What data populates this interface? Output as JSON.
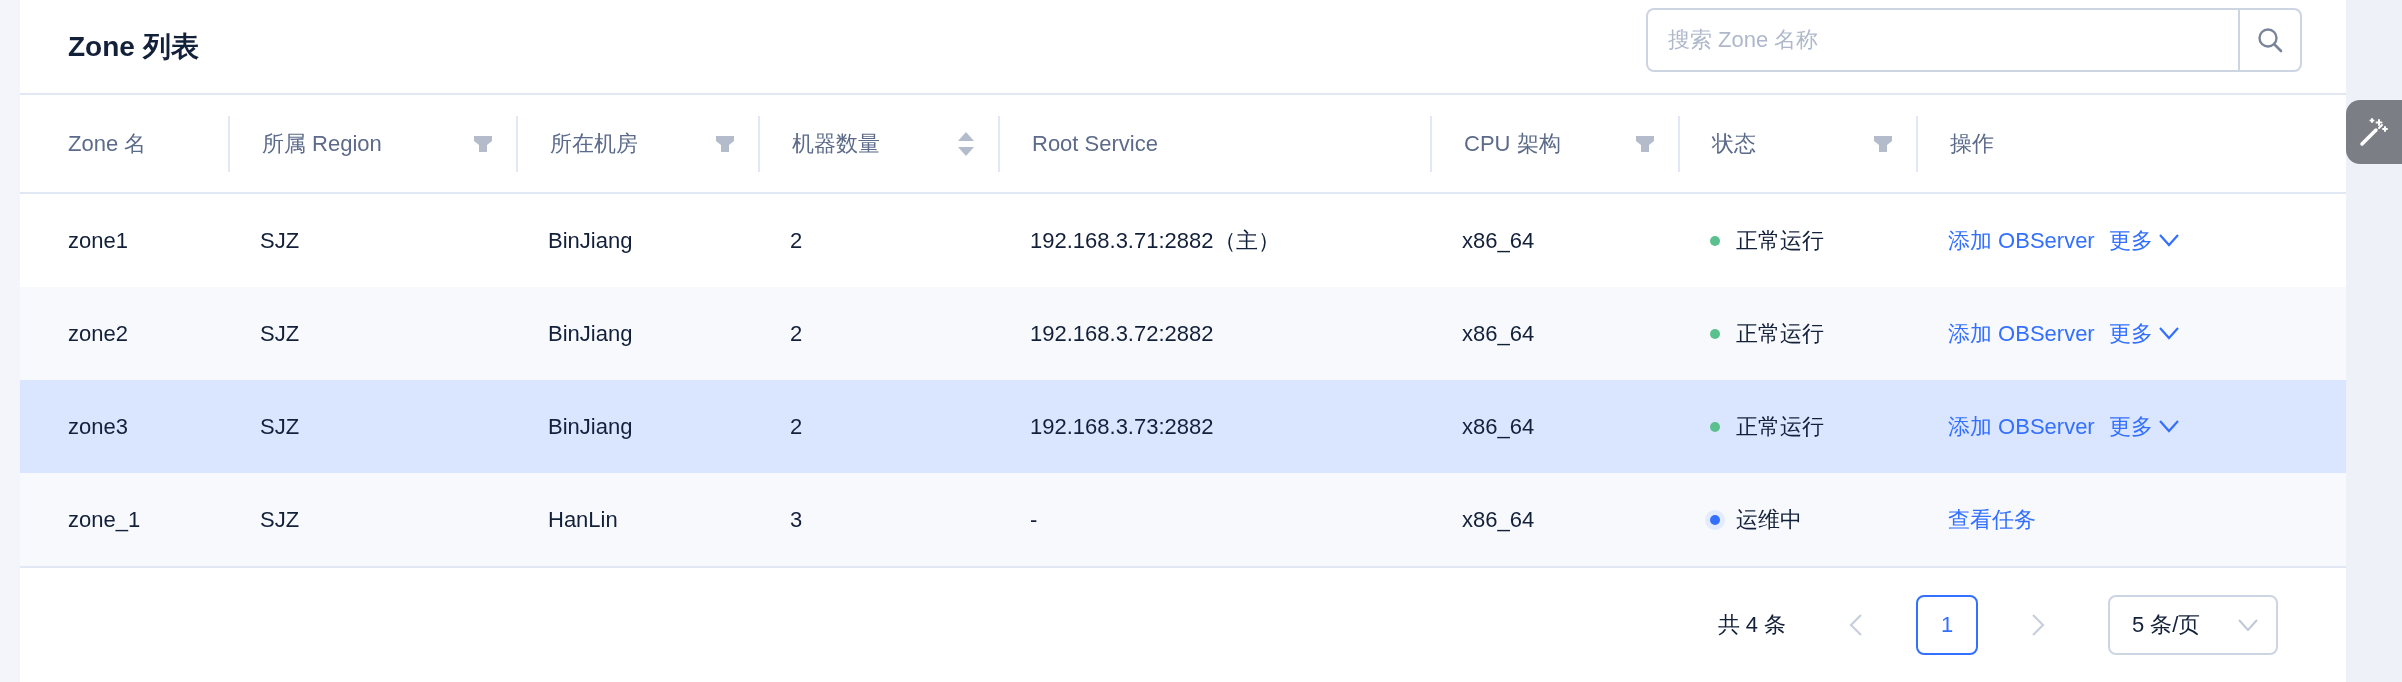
{
  "title": "Zone 列表",
  "search": {
    "placeholder": "搜索 Zone 名称"
  },
  "table": {
    "columns": [
      {
        "label": "Zone 名",
        "kind": "plain"
      },
      {
        "label": "所属 Region",
        "kind": "filter"
      },
      {
        "label": "所在机房",
        "kind": "filter"
      },
      {
        "label": "机器数量",
        "kind": "sort"
      },
      {
        "label": "Root Service",
        "kind": "plain"
      },
      {
        "label": "CPU 架构",
        "kind": "filter"
      },
      {
        "label": "状态",
        "kind": "filter"
      },
      {
        "label": "操作",
        "kind": "plain"
      }
    ],
    "rows": [
      {
        "cells": [
          "zone1",
          "SJZ",
          "BinJiang",
          "2",
          "192.168.3.71:2882（主）",
          "x86_64"
        ],
        "status": {
          "label": "正常运行",
          "kind": "static",
          "color": "#5ac18e"
        },
        "actions": [
          {
            "label": "添加 OBServer",
            "kind": "link"
          },
          {
            "label": "更多",
            "kind": "dropdown"
          }
        ],
        "selected": false
      },
      {
        "cells": [
          "zone2",
          "SJZ",
          "BinJiang",
          "2",
          "192.168.3.72:2882",
          "x86_64"
        ],
        "status": {
          "label": "正常运行",
          "kind": "static",
          "color": "#5ac18e"
        },
        "actions": [
          {
            "label": "添加 OBServer",
            "kind": "link"
          },
          {
            "label": "更多",
            "kind": "dropdown"
          }
        ],
        "selected": false
      },
      {
        "cells": [
          "zone3",
          "SJZ",
          "BinJiang",
          "2",
          "192.168.3.73:2882",
          "x86_64"
        ],
        "status": {
          "label": "正常运行",
          "kind": "static",
          "color": "#5ac18e"
        },
        "actions": [
          {
            "label": "添加 OBServer",
            "kind": "link"
          },
          {
            "label": "更多",
            "kind": "dropdown"
          }
        ],
        "selected": true
      },
      {
        "cells": [
          "zone_1",
          "SJZ",
          "HanLin",
          "3",
          "-",
          "x86_64"
        ],
        "status": {
          "label": "运维中",
          "kind": "processing",
          "color": "#3370ff"
        },
        "actions": [
          {
            "label": "查看任务",
            "kind": "link"
          }
        ],
        "selected": false
      }
    ]
  },
  "pagination": {
    "total": "共 4 条",
    "prev": {
      "disabled": true
    },
    "pages": [
      {
        "label": "1",
        "selected": true
      }
    ],
    "next": {
      "disabled": true
    },
    "page_size": "5 条/页"
  }
}
